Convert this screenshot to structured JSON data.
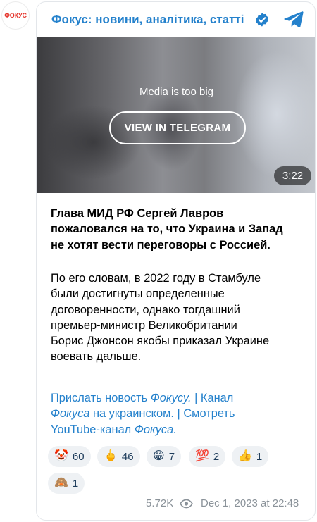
{
  "channel": {
    "avatar_text": "ФОКУС",
    "name": "Фокус: новини, аналітика, статті"
  },
  "media": {
    "message": "Media is too big",
    "button_label": "VIEW IN TELEGRAM",
    "duration": "3:22"
  },
  "post": {
    "lead_lines": [
      "Глава МИД РФ Сергей Лавров",
      "пожаловался на то, что Украина и Запад",
      "не хотят вести переговоры с Россией."
    ],
    "body_lines": [
      "По его словам, в 2022 году в Стамбуле",
      "были достигнуты определенные",
      "договоренности, однако тогдашний",
      "премьер-министр Великобритании",
      "Борис Джонсон якобы приказал Украине",
      "воевать дальше."
    ],
    "links": {
      "send_news_prefix": "Прислать новость ",
      "send_news_italic": "Фокусу.",
      "sep1": " | ",
      "channel_prefix": "Канал",
      "channel_italic": "Фокуса",
      "channel_suffix": " на украинском.",
      "sep2": " | ",
      "watch_prefix": "Смотреть",
      "youtube_prefix": "YouTube-канал ",
      "youtube_italic": "Фокуса."
    }
  },
  "reactions": [
    {
      "emoji": "🤡",
      "count": "60"
    },
    {
      "emoji": "🖕",
      "count": "46"
    },
    {
      "emoji": "😁",
      "count": "7"
    },
    {
      "emoji": "💯",
      "count": "2"
    },
    {
      "emoji": "👍",
      "count": "1"
    },
    {
      "emoji": "🙈",
      "count": "1"
    }
  ],
  "footer": {
    "views": "5.72K",
    "date": "Dec 1, 2023 at 22:48"
  },
  "colors": {
    "link": "#2481cc",
    "brand_red": "#e5342b",
    "muted": "#8a9299"
  },
  "icons": [
    "verified-icon",
    "telegram-icon",
    "eye-icon"
  ]
}
